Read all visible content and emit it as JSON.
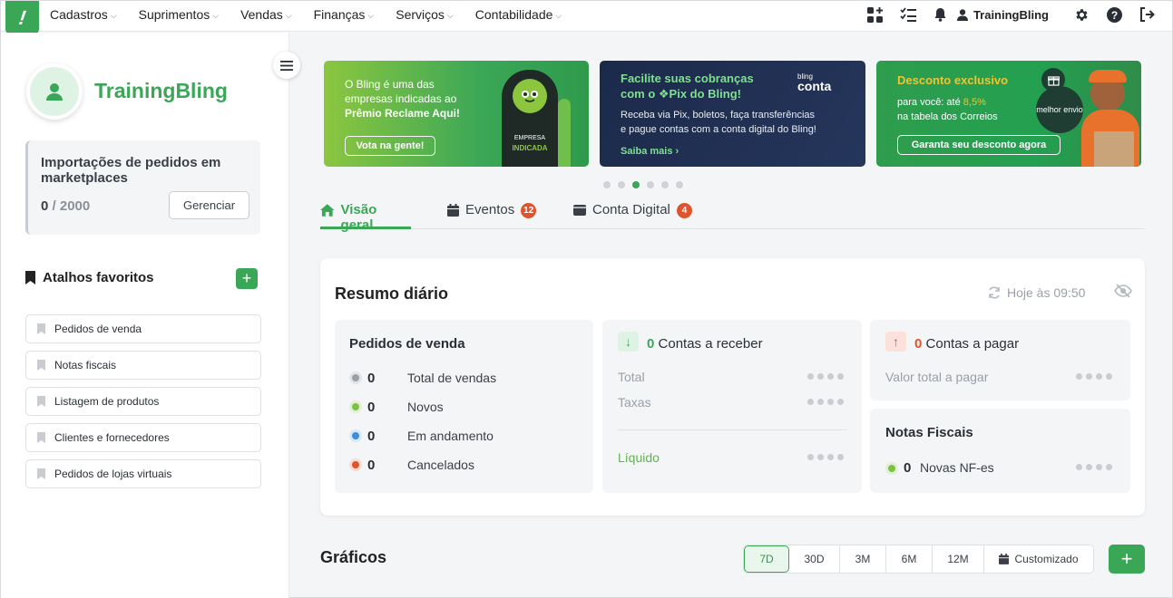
{
  "nav": {
    "logo_text": "!",
    "menu": [
      {
        "label": "Cadastros"
      },
      {
        "label": "Suprimentos"
      },
      {
        "label": "Vendas"
      },
      {
        "label": "Finanças"
      },
      {
        "label": "Serviços"
      },
      {
        "label": "Contabilidade"
      }
    ],
    "user_name": "TrainingBling"
  },
  "sidebar": {
    "company_name": "TrainingBling",
    "import_card": {
      "title": "Importações de pedidos em marketplaces",
      "used": "0",
      "separator": "/",
      "total": "2000",
      "button_label": "Gerenciar"
    },
    "favorites_title": "Atalhos favoritos",
    "favorites_add": "+",
    "favorites": [
      "Pedidos de venda",
      "Notas fiscais",
      "Listagem de produtos",
      "Clientes e fornecedores",
      "Pedidos de lojas virtuais"
    ]
  },
  "banners": [
    {
      "line1": "O Bling é uma das",
      "line2": "empresas indicadas ao",
      "line3": "Prêmio Reclame Aqui!",
      "cta": "Vota na gente!",
      "badge_line1": "EMPRESA",
      "badge_line2": "INDICADA"
    },
    {
      "title1": "Facilite suas cobranças",
      "title2": "com o ❖Pix do Bling!",
      "body1": "Receba via Pix, boletos, faça transferências",
      "body2": "e pague contas com a conta digital do Bling!",
      "cta": "Saiba mais ›",
      "brand_small": "bling",
      "brand": "conta"
    },
    {
      "title": "Desconto exclusivo",
      "body1_prefix": "para você: até ",
      "body1_highlight": "8,5%",
      "body2": "na tabela dos Correios",
      "cta": "Garanta seu desconto agora",
      "brand": "melhor envio"
    }
  ],
  "carousel": {
    "count": 6,
    "active_index": 2
  },
  "tabs": [
    {
      "label": "Visão geral",
      "active": true,
      "badge": ""
    },
    {
      "label": "Eventos",
      "active": false,
      "badge": "12"
    },
    {
      "label": "Conta Digital",
      "active": false,
      "badge": "4"
    }
  ],
  "summary": {
    "title": "Resumo diário",
    "updated": "Hoje às 09:50",
    "sales": {
      "title": "Pedidos de venda",
      "rows": [
        {
          "value": "0",
          "label": "Total de vendas",
          "color": "#9aa0a8"
        },
        {
          "value": "0",
          "label": "Novos",
          "color": "#7cc242"
        },
        {
          "value": "0",
          "label": "Em andamento",
          "color": "#3b8fd9"
        },
        {
          "value": "0",
          "label": "Cancelados",
          "color": "#e0542b"
        }
      ]
    },
    "receivable": {
      "count": "0",
      "title": "Contas a receber",
      "arrow": "↓",
      "rows": [
        "Total",
        "Taxas"
      ],
      "net_label": "Líquido"
    },
    "payable": {
      "count": "0",
      "title": "Contas a pagar",
      "arrow": "↑",
      "row": "Valor total a pagar"
    },
    "invoices": {
      "title": "Notas Fiscais",
      "count": "0",
      "label": "Novas NF-es"
    }
  },
  "charts": {
    "title": "Gráficos",
    "ranges": [
      "7D",
      "30D",
      "3M",
      "6M",
      "12M",
      "Customizado"
    ],
    "active_range": "7D",
    "add": "+"
  },
  "colors": {
    "brand_green": "#3aa757",
    "badge_red": "#e0542b",
    "pix_navy": "#1c2a4a"
  }
}
